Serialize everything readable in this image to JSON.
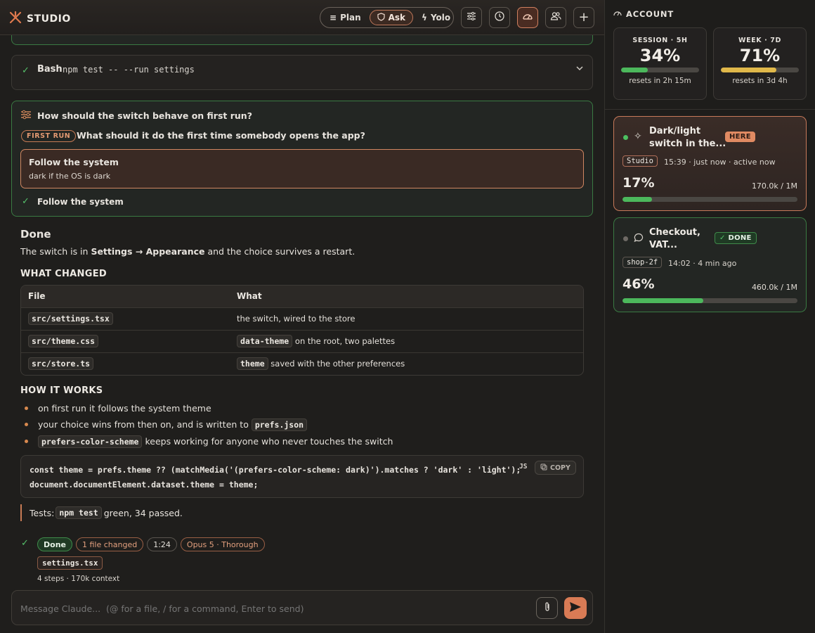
{
  "header": {
    "brand": "STUDIO",
    "modes": [
      {
        "label": "Plan"
      },
      {
        "label": "Ask"
      },
      {
        "label": "Yolo"
      }
    ]
  },
  "tool": {
    "name": "Bash",
    "command": "npm test -- --run settings"
  },
  "question": {
    "title": "How should the switch behave on first run?",
    "tag": "FIRST RUN",
    "prompt": "What should it do the first time somebody opens the app?",
    "option_title": "Follow the system",
    "option_desc": "dark if the OS is dark",
    "answer": "Follow the system"
  },
  "done": {
    "heading": "Done",
    "text_a": "The switch is in ",
    "text_b": "Settings → Appearance",
    "text_c": " and the choice survives a restart."
  },
  "changed": {
    "heading": "WHAT CHANGED",
    "columns": [
      "File",
      "What"
    ],
    "rows": [
      {
        "file": "src/settings.tsx",
        "what": "the switch, wired to the store",
        "code": "",
        "rest": ""
      },
      {
        "file": "src/theme.css",
        "what": "",
        "code": "data-theme",
        "rest": " on the root, two palettes"
      },
      {
        "file": "src/store.ts",
        "what": "",
        "code": "theme",
        "rest": " saved with the other preferences"
      }
    ]
  },
  "how": {
    "heading": "HOW IT WORKS",
    "b1": "on first run it follows the system theme",
    "b2a": "your choice wins from then on, and is written to ",
    "b2code": "prefs.json",
    "b3code": "prefers-color-scheme",
    "b3b": " keeps working for anyone who never touches the switch"
  },
  "code": {
    "line1": "const theme = prefs.theme ?? (matchMedia('(prefers-color-scheme: dark)').matches ? 'dark' : 'light');",
    "line2": "document.documentElement.dataset.theme = theme;",
    "copy": "COPY",
    "lang": "JS"
  },
  "tests": {
    "a": "Tests: ",
    "code": "npm test",
    "b": " green, 34 passed."
  },
  "status": {
    "done": "Done",
    "files": "1 file changed",
    "time": "1:24",
    "model": "Opus 5 · Thorough",
    "file": "settings.tsx",
    "steps": "4 steps · 170k context"
  },
  "composer": {
    "placeholder": "Message Claude...  (@ for a file, / for a command, Enter to send)"
  },
  "account": {
    "heading": "ACCOUNT",
    "session": {
      "label": "SESSION · 5H",
      "pct": "34%",
      "fill": 0.34,
      "reset": "resets in 2h 15m",
      "color": "#4cb85c"
    },
    "week": {
      "label": "WEEK · 7D",
      "pct": "71%",
      "fill": 0.71,
      "reset": "resets in 3d 4h",
      "color": "#e0b84a"
    }
  },
  "sessions": [
    {
      "title1": "Dark/light",
      "title2": "switch in the...",
      "badge": "HERE",
      "tag": "Studio",
      "meta": "15:39 · just now · active now",
      "pct": "17%",
      "fill": 0.17,
      "tokens": "170.0k / 1M"
    },
    {
      "title1": "Checkout,",
      "title2": "VAT...",
      "badge": "DONE",
      "tag": "shop-2f",
      "meta": "14:02 · 4 min ago",
      "pct": "46%",
      "fill": 0.46,
      "tokens": "460.0k / 1M"
    }
  ]
}
